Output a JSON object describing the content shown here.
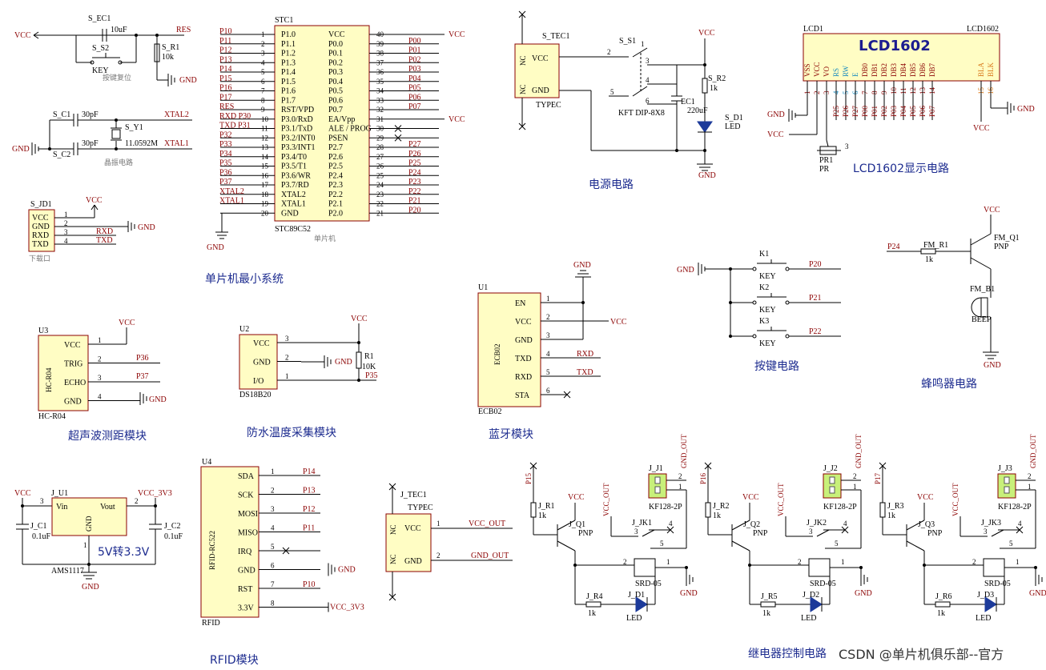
{
  "titles": {
    "mcu": "单片机最小系统",
    "power": "电源电路",
    "lcd": "LCD1602显示电路",
    "keys": "按键电路",
    "buzzer": "蜂鸣器电路",
    "ultrasonic": "超声波测距模块",
    "temp": "防水温度采集模块",
    "bt": "蓝牙模块",
    "rfid": "RFID模块",
    "relay": "继电器控制电路",
    "reg": "5V转3.3V",
    "watermark": "CSDN @单片机俱乐部--官方",
    "reset_caption": "按键复位",
    "crystal_caption": "晶振电路",
    "download_caption": "下载口",
    "mcu_caption": "单片机"
  },
  "mcu": {
    "ref": "STC1",
    "part": "STC89C52",
    "left_pins": [
      {
        "n": "1",
        "label": "P1.0",
        "net": "P10"
      },
      {
        "n": "2",
        "label": "P1.1",
        "net": "P11"
      },
      {
        "n": "3",
        "label": "P1.2",
        "net": "P12"
      },
      {
        "n": "4",
        "label": "P1.3",
        "net": "P13"
      },
      {
        "n": "5",
        "label": "P1.4",
        "net": "P14"
      },
      {
        "n": "6",
        "label": "P1.5",
        "net": "P15"
      },
      {
        "n": "7",
        "label": "P1.6",
        "net": "P16"
      },
      {
        "n": "8",
        "label": "P1.7",
        "net": "P17"
      },
      {
        "n": "9",
        "label": "RST/VPD",
        "net": "RES"
      },
      {
        "n": "10",
        "label": "P3.0/RxD",
        "net": "RXD P30"
      },
      {
        "n": "11",
        "label": "P3.1/TxD",
        "net": "TXD P31"
      },
      {
        "n": "12",
        "label": "P3.2/INT0",
        "net": "P32"
      },
      {
        "n": "13",
        "label": "P3.3/INT1",
        "net": "P33"
      },
      {
        "n": "14",
        "label": "P3.4/T0",
        "net": "P34"
      },
      {
        "n": "15",
        "label": "P3.5/T1",
        "net": "P35"
      },
      {
        "n": "16",
        "label": "P3.6/WR",
        "net": "P36"
      },
      {
        "n": "17",
        "label": "P3.7/RD",
        "net": "P37"
      },
      {
        "n": "18",
        "label": "XTAL2",
        "net": "XTAL2"
      },
      {
        "n": "19",
        "label": "XTAL1",
        "net": "XTAL1"
      },
      {
        "n": "20",
        "label": "GND",
        "net": ""
      }
    ],
    "right_pins": [
      {
        "n": "40",
        "label": "VCC",
        "net": "VCC"
      },
      {
        "n": "39",
        "label": "P0.0",
        "net": "P00"
      },
      {
        "n": "38",
        "label": "P0.1",
        "net": "P01"
      },
      {
        "n": "37",
        "label": "P0.2",
        "net": "P02"
      },
      {
        "n": "36",
        "label": "P0.3",
        "net": "P03"
      },
      {
        "n": "35",
        "label": "P0.4",
        "net": "P04"
      },
      {
        "n": "34",
        "label": "P0.5",
        "net": "P05"
      },
      {
        "n": "33",
        "label": "P0.6",
        "net": "P06"
      },
      {
        "n": "32",
        "label": "P0.7",
        "net": "P07"
      },
      {
        "n": "31",
        "label": "EA/Vpp",
        "net": "VCC"
      },
      {
        "n": "30",
        "label": "ALE / PROG",
        "net": ""
      },
      {
        "n": "29",
        "label": "PSEN",
        "net": ""
      },
      {
        "n": "28",
        "label": "P2.7",
        "net": "P27"
      },
      {
        "n": "27",
        "label": "P2.6",
        "net": "P26"
      },
      {
        "n": "26",
        "label": "P2.5",
        "net": "P25"
      },
      {
        "n": "25",
        "label": "P2.4",
        "net": "P24"
      },
      {
        "n": "24",
        "label": "P2.3",
        "net": "P23"
      },
      {
        "n": "23",
        "label": "P2.2",
        "net": "P22"
      },
      {
        "n": "22",
        "label": "P2.1",
        "net": "P21"
      },
      {
        "n": "21",
        "label": "P2.0",
        "net": "P20"
      }
    ]
  },
  "reset": {
    "ec": "S_EC1",
    "cap": "10uF",
    "key": "S_S2",
    "keylabel": "KEY",
    "r": "S_R1",
    "rval": "10k",
    "net": "RES",
    "vcc": "VCC",
    "gnd": "GND"
  },
  "crystal": {
    "c1": "S_C1",
    "c2": "S_C2",
    "cval": "30pF",
    "y": "S_Y1",
    "freq": "11.0592M",
    "n1": "XTAL2",
    "n2": "XTAL1",
    "gnd": "GND"
  },
  "download": {
    "ref": "S_JD1",
    "pins": [
      "VCC",
      "GND",
      "RXD",
      "TXD"
    ],
    "nums": [
      "1",
      "2",
      "3",
      "4"
    ],
    "vcc": "VCC",
    "gnd": "GND",
    "rxd": "RXD",
    "txd": "TXD"
  },
  "power": {
    "ref": "S_TEC1",
    "part": "TYPEC",
    "sw": "S_S1",
    "swpart": "KFT DIP-8X8",
    "r": "S_R2",
    "rval": "1k",
    "ec": "EC1",
    "ecval": "220uF",
    "d": "S_D1",
    "dpart": "LED",
    "vcc": "VCC",
    "gnd": "GND",
    "nc": "NC",
    "pvcc": "VCC",
    "pgnd": "GND"
  },
  "lcd": {
    "ref": "LCD1",
    "part": "LCD1602",
    "name": "LCD1602",
    "pins": [
      "VSS",
      "VCC",
      "VO",
      "RS",
      "RW",
      "E",
      "DB0",
      "DB1",
      "DB2",
      "DB3",
      "DB4",
      "DB5",
      "DB6",
      "DB7",
      "BLA",
      "BLK"
    ],
    "nums": [
      "1",
      "2",
      "3",
      "4",
      "5",
      "6",
      "7",
      "8",
      "9",
      "10",
      "11",
      "12",
      "13",
      "14",
      "15",
      "16"
    ],
    "nets": [
      "",
      "",
      "",
      "P25",
      "P26",
      "P27",
      "P00",
      "P01",
      "P02",
      "P03",
      "P04",
      "P05",
      "P06",
      "P07",
      "",
      ""
    ],
    "pr": "PR1",
    "prlabel": "PR",
    "gnd": "GND",
    "vcc": "VCC"
  },
  "keys": {
    "gnd": "GND",
    "items": [
      {
        "ref": "K1",
        "label": "KEY",
        "net": "P20"
      },
      {
        "ref": "K2",
        "label": "KEY",
        "net": "P21"
      },
      {
        "ref": "K3",
        "label": "KEY",
        "net": "P22"
      }
    ]
  },
  "buzzer": {
    "vcc": "VCC",
    "q": "FM_Q1",
    "qpart": "PNP",
    "r": "FM_R1",
    "rval": "1k",
    "b": "FM_B1",
    "bpart": "BEEP",
    "net": "P24",
    "gnd": "GND"
  },
  "ultrasonic": {
    "ref": "U3",
    "part": "HC-R04",
    "pins": [
      "VCC",
      "TRIG",
      "ECHO",
      "GND"
    ],
    "nums": [
      "1",
      "2",
      "3",
      "4"
    ],
    "vcc": "VCC",
    "n2": "P36",
    "n3": "P37",
    "gnd": "GND",
    "bodylabel": "HC-R04"
  },
  "temp": {
    "ref": "U2",
    "part": "DS18B20",
    "pins": [
      "VCC",
      "GND",
      "I/O"
    ],
    "nums": [
      "3",
      "2",
      "1"
    ],
    "vcc": "VCC",
    "gnd": "GND",
    "r": "R1",
    "rval": "10K",
    "net": "P35"
  },
  "bt": {
    "ref": "U1",
    "part": "ECB02",
    "pins": [
      "EN",
      "VCC",
      "GND",
      "TXD",
      "RXD",
      "STA"
    ],
    "nums": [
      "1",
      "2",
      "3",
      "4",
      "5",
      "6"
    ],
    "vcc": "VCC",
    "gnd": "GND",
    "rxd": "RXD",
    "txd": "TXD",
    "bodylabel": "ECB02"
  },
  "regulator": {
    "ref": "J_U1",
    "part": "AMS1117",
    "vin": "Vin",
    "vout": "Vout",
    "gnd": "GND",
    "c1": "J_C1",
    "c1v": "0.1uF",
    "c2": "J_C2",
    "c2v": "0.1uF",
    "vcc": "VCC",
    "vcc33": "VCC_3V3",
    "n1": "3",
    "n2": "2",
    "n3": "1",
    "ggnd": "GND"
  },
  "rfid": {
    "ref": "U4",
    "part": "RFID",
    "bodylabel": "RFID-RC522",
    "pins": [
      "SDA",
      "SCK",
      "MOSI",
      "MISO",
      "IRQ",
      "GND",
      "RST",
      "3.3V"
    ],
    "nums": [
      "1",
      "2",
      "3",
      "4",
      "5",
      "6",
      "7",
      "8"
    ],
    "nets": [
      "P14",
      "P13",
      "P12",
      "P11",
      "",
      "GND",
      "P10",
      "VCC_3V3"
    ]
  },
  "typec2": {
    "ref": "J_TEC1",
    "part": "TYPEC",
    "nc": "NC",
    "vcc": "VCC",
    "gnd": "GND",
    "n1": "1",
    "n2": "2",
    "out1": "VCC_OUT",
    "out2": "GND_OUT"
  },
  "relays": [
    {
      "net": "P15",
      "r": "J_R1",
      "q": "J_Q1",
      "jk": "J_JK1",
      "j": "J_J1",
      "r2": "J_R4",
      "d": "J_D1"
    },
    {
      "net": "P16",
      "r": "J_R2",
      "q": "J_Q2",
      "jk": "J_JK2",
      "j": "J_J2",
      "r2": "J_R5",
      "d": "J_D2"
    },
    {
      "net": "P17",
      "r": "J_R3",
      "q": "J_Q3",
      "jk": "J_JK3",
      "j": "J_J3",
      "r2": "J_R6",
      "d": "J_D3"
    }
  ],
  "relay_common": {
    "rval": "1k",
    "qpart": "PNP",
    "vcc": "VCC",
    "vccout": "VCC_OUT",
    "gndout": "GND_OUT",
    "jpart": "KF128-2P",
    "srd": "SRD-05",
    "led": "LED",
    "gnd": "GND"
  },
  "colors": {
    "box_fill": "#fffdc4",
    "box_stroke": "#8b0000",
    "net": "#8b0000",
    "title": "#1c2b8f",
    "terminal": "#c8f07a"
  }
}
